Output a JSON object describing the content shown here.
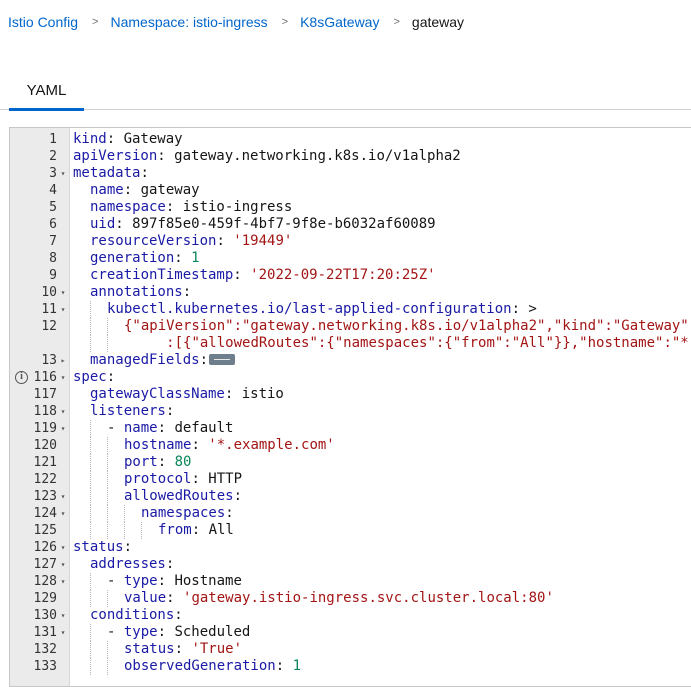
{
  "breadcrumb": {
    "items": [
      "Istio Config",
      "Namespace: istio-ingress",
      "K8sGateway"
    ],
    "current": "gateway",
    "separator": ">"
  },
  "tabs": [
    {
      "label": "YAML",
      "active": true
    }
  ],
  "editor": {
    "lines": [
      {
        "num": "1",
        "fold": "",
        "tokens": [
          [
            "k",
            "kind"
          ],
          [
            "p",
            ": "
          ],
          [
            "v",
            "Gateway"
          ]
        ]
      },
      {
        "num": "2",
        "fold": "",
        "tokens": [
          [
            "k",
            "apiVersion"
          ],
          [
            "p",
            ": "
          ],
          [
            "v",
            "gateway.networking.k8s.io/v1alpha2"
          ]
        ]
      },
      {
        "num": "3",
        "fold": "▾",
        "tokens": [
          [
            "k",
            "metadata"
          ],
          [
            "p",
            ":"
          ]
        ]
      },
      {
        "num": "4",
        "fold": "",
        "indent": 1,
        "tokens": [
          [
            "k",
            "name"
          ],
          [
            "p",
            ": "
          ],
          [
            "v",
            "gateway"
          ]
        ]
      },
      {
        "num": "5",
        "fold": "",
        "indent": 1,
        "tokens": [
          [
            "k",
            "namespace"
          ],
          [
            "p",
            ": "
          ],
          [
            "v",
            "istio-ingress"
          ]
        ]
      },
      {
        "num": "6",
        "fold": "",
        "indent": 1,
        "tokens": [
          [
            "k",
            "uid"
          ],
          [
            "p",
            ": "
          ],
          [
            "v",
            "897f85e0-459f-4bf7-9f8e-b6032af60089"
          ]
        ]
      },
      {
        "num": "7",
        "fold": "",
        "indent": 1,
        "tokens": [
          [
            "k",
            "resourceVersion"
          ],
          [
            "p",
            ": "
          ],
          [
            "s",
            "'19449'"
          ]
        ]
      },
      {
        "num": "8",
        "fold": "",
        "indent": 1,
        "tokens": [
          [
            "k",
            "generation"
          ],
          [
            "p",
            ": "
          ],
          [
            "n",
            "1"
          ]
        ]
      },
      {
        "num": "9",
        "fold": "",
        "indent": 1,
        "tokens": [
          [
            "k",
            "creationTimestamp"
          ],
          [
            "p",
            ": "
          ],
          [
            "s",
            "'2022-09-22T17:20:25Z'"
          ]
        ]
      },
      {
        "num": "10",
        "fold": "▾",
        "indent": 1,
        "tokens": [
          [
            "k",
            "annotations"
          ],
          [
            "p",
            ":"
          ]
        ]
      },
      {
        "num": "11",
        "fold": "▾",
        "indent": 2,
        "tokens": [
          [
            "k",
            "kubectl.kubernetes.io/last-applied-configuration"
          ],
          [
            "p",
            ": >"
          ]
        ]
      },
      {
        "num": "12",
        "fold": "",
        "indent": 3,
        "tokens": [
          [
            "s",
            "{\"apiVersion\":\"gateway.networking.k8s.io/v1alpha2\",\"kind\":\"Gateway\""
          ]
        ]
      },
      {
        "num": "",
        "fold": "",
        "indent": 3,
        "pad": "     ",
        "tokens": [
          [
            "s",
            ":[{\"allowedRoutes\":{\"namespaces\":{\"from\":\"All\"}},\"hostname\":\"*.e"
          ]
        ]
      },
      {
        "num": "13",
        "fold": "▸",
        "indent": 1,
        "widget": true,
        "tokens": [
          [
            "k",
            "managedFields"
          ],
          [
            "p",
            ":"
          ]
        ]
      },
      {
        "num": "116",
        "fold": "▾",
        "info": true,
        "tokens": [
          [
            "k",
            "spec"
          ],
          [
            "p",
            ":"
          ]
        ]
      },
      {
        "num": "117",
        "fold": "",
        "indent": 1,
        "tokens": [
          [
            "k",
            "gatewayClassName"
          ],
          [
            "p",
            ": "
          ],
          [
            "v",
            "istio"
          ]
        ]
      },
      {
        "num": "118",
        "fold": "▾",
        "indent": 1,
        "tokens": [
          [
            "k",
            "listeners"
          ],
          [
            "p",
            ":"
          ]
        ]
      },
      {
        "num": "119",
        "fold": "▾",
        "indent": 2,
        "tokens": [
          [
            "p",
            "- "
          ],
          [
            "k",
            "name"
          ],
          [
            "p",
            ": "
          ],
          [
            "v",
            "default"
          ]
        ]
      },
      {
        "num": "120",
        "fold": "",
        "indent": 3,
        "tokens": [
          [
            "k",
            "hostname"
          ],
          [
            "p",
            ": "
          ],
          [
            "s",
            "'*.example.com'"
          ]
        ]
      },
      {
        "num": "121",
        "fold": "",
        "indent": 3,
        "tokens": [
          [
            "k",
            "port"
          ],
          [
            "p",
            ": "
          ],
          [
            "n",
            "80"
          ]
        ]
      },
      {
        "num": "122",
        "fold": "",
        "indent": 3,
        "tokens": [
          [
            "k",
            "protocol"
          ],
          [
            "p",
            ": "
          ],
          [
            "v",
            "HTTP"
          ]
        ]
      },
      {
        "num": "123",
        "fold": "▾",
        "indent": 3,
        "tokens": [
          [
            "k",
            "allowedRoutes"
          ],
          [
            "p",
            ":"
          ]
        ]
      },
      {
        "num": "124",
        "fold": "▾",
        "indent": 4,
        "tokens": [
          [
            "k",
            "namespaces"
          ],
          [
            "p",
            ":"
          ]
        ]
      },
      {
        "num": "125",
        "fold": "",
        "indent": 5,
        "tokens": [
          [
            "k",
            "from"
          ],
          [
            "p",
            ": "
          ],
          [
            "v",
            "All"
          ]
        ]
      },
      {
        "num": "126",
        "fold": "▾",
        "tokens": [
          [
            "k",
            "status"
          ],
          [
            "p",
            ":"
          ]
        ]
      },
      {
        "num": "127",
        "fold": "▾",
        "indent": 1,
        "tokens": [
          [
            "k",
            "addresses"
          ],
          [
            "p",
            ":"
          ]
        ]
      },
      {
        "num": "128",
        "fold": "▾",
        "indent": 2,
        "tokens": [
          [
            "p",
            "- "
          ],
          [
            "k",
            "type"
          ],
          [
            "p",
            ": "
          ],
          [
            "v",
            "Hostname"
          ]
        ]
      },
      {
        "num": "129",
        "fold": "",
        "indent": 3,
        "tokens": [
          [
            "k",
            "value"
          ],
          [
            "p",
            ": "
          ],
          [
            "s",
            "'gateway.istio-ingress.svc.cluster.local:80'"
          ]
        ]
      },
      {
        "num": "130",
        "fold": "▾",
        "indent": 1,
        "tokens": [
          [
            "k",
            "conditions"
          ],
          [
            "p",
            ":"
          ]
        ]
      },
      {
        "num": "131",
        "fold": "▾",
        "indent": 2,
        "tokens": [
          [
            "p",
            "- "
          ],
          [
            "k",
            "type"
          ],
          [
            "p",
            ": "
          ],
          [
            "v",
            "Scheduled"
          ]
        ]
      },
      {
        "num": "132",
        "fold": "",
        "indent": 3,
        "tokens": [
          [
            "k",
            "status"
          ],
          [
            "p",
            ": "
          ],
          [
            "s",
            "'True'"
          ]
        ]
      },
      {
        "num": "133",
        "fold": "",
        "indent": 3,
        "tokens": [
          [
            "k",
            "observedGeneration"
          ],
          [
            "p",
            ": "
          ],
          [
            "n",
            "1"
          ]
        ]
      }
    ]
  }
}
